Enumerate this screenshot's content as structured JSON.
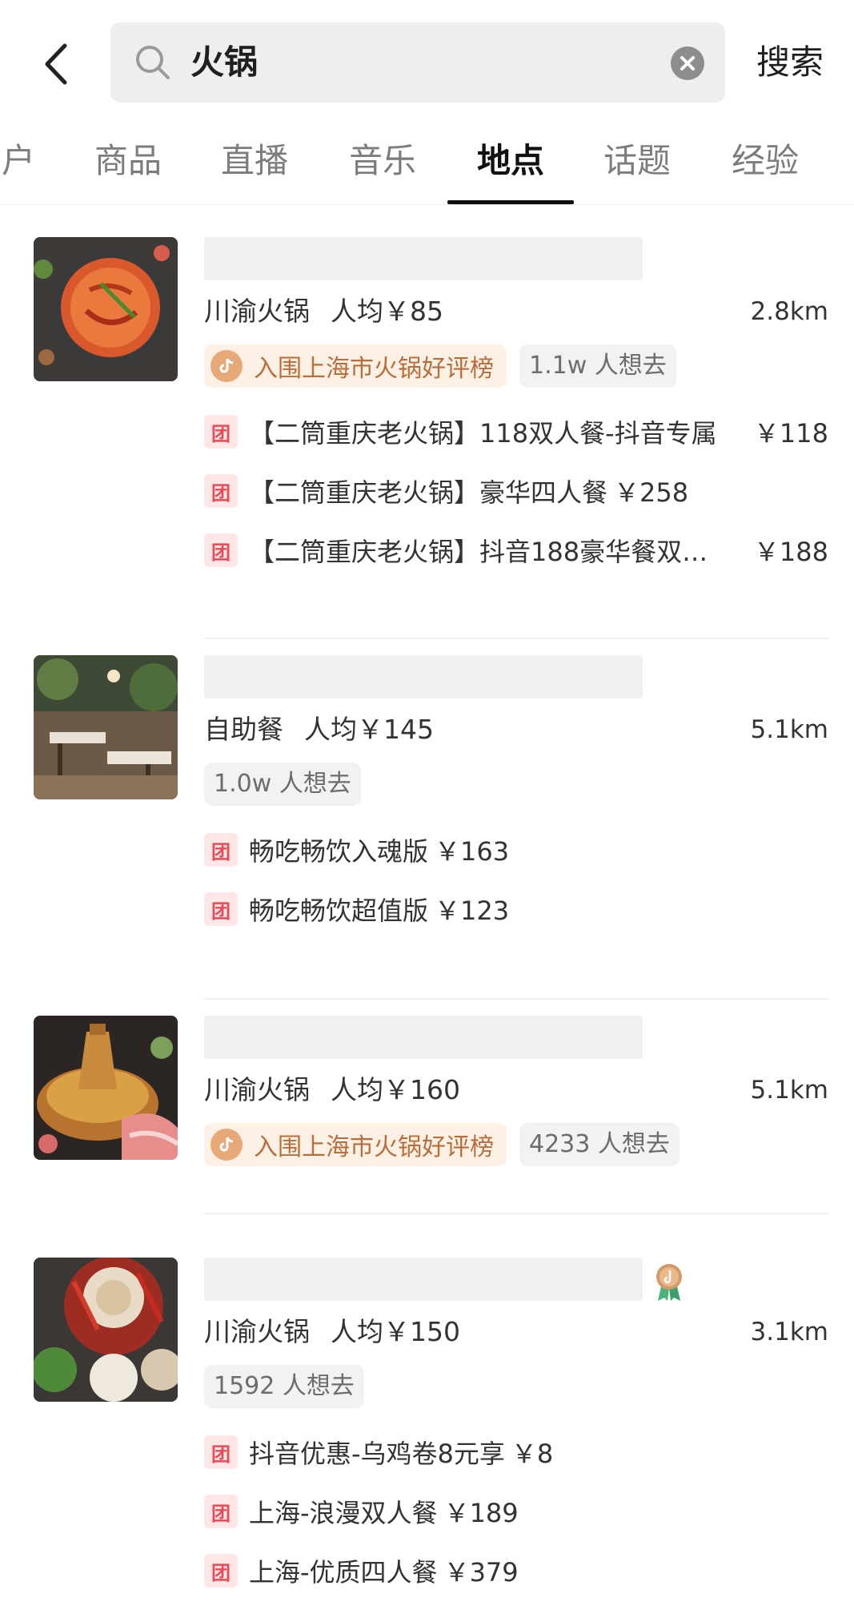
{
  "search": {
    "query": "火锅",
    "button_label": "搜索"
  },
  "tabs": [
    {
      "label": "户"
    },
    {
      "label": "商品"
    },
    {
      "label": "直播"
    },
    {
      "label": "音乐"
    },
    {
      "label": "地点",
      "active": true
    },
    {
      "label": "话题"
    },
    {
      "label": "经验"
    }
  ],
  "results": [
    {
      "category": "川渝火锅",
      "avg_price": "人均￥85",
      "distance": "2.8km",
      "rank_badge": "入围上海市火锅好评榜",
      "want_count": "1.1w 人想去",
      "deals": [
        {
          "tag": "团",
          "title": "【二筒重庆老火锅】118双人餐-抖音专属",
          "price": "￥118"
        },
        {
          "tag": "团",
          "title": "【二筒重庆老火锅】豪华四人餐",
          "price": "￥258"
        },
        {
          "tag": "团",
          "title": "【二筒重庆老火锅】抖音188豪华餐双…",
          "price": "￥188"
        }
      ]
    },
    {
      "category": "自助餐",
      "avg_price": "人均￥145",
      "distance": "5.1km",
      "want_count": "1.0w 人想去",
      "deals": [
        {
          "tag": "团",
          "title": "畅吃畅饮入魂版",
          "price": "￥163"
        },
        {
          "tag": "团",
          "title": "畅吃畅饮超值版",
          "price": "￥123"
        }
      ]
    },
    {
      "category": "川渝火锅",
      "avg_price": "人均￥160",
      "distance": "5.1km",
      "rank_badge": "入围上海市火锅好评榜",
      "want_count": "4233 人想去"
    },
    {
      "category": "川渝火锅",
      "avg_price": "人均￥150",
      "distance": "3.1km",
      "want_count": "1592 人想去",
      "deals": [
        {
          "tag": "团",
          "title": "抖音优惠-乌鸡卷8元享",
          "price": "￥8"
        },
        {
          "tag": "团",
          "title": "上海-浪漫双人餐",
          "price": "￥189"
        },
        {
          "tag": "团",
          "title": "上海-优质四人餐",
          "price": "￥379"
        }
      ]
    }
  ],
  "colors": {
    "accent_tab": "#111111",
    "rank_tag_bg": "#fdf0e4",
    "rank_tag_text": "#b86e3a",
    "tuan_bg": "#ffe7e8",
    "tuan_text": "#ea4a55"
  }
}
